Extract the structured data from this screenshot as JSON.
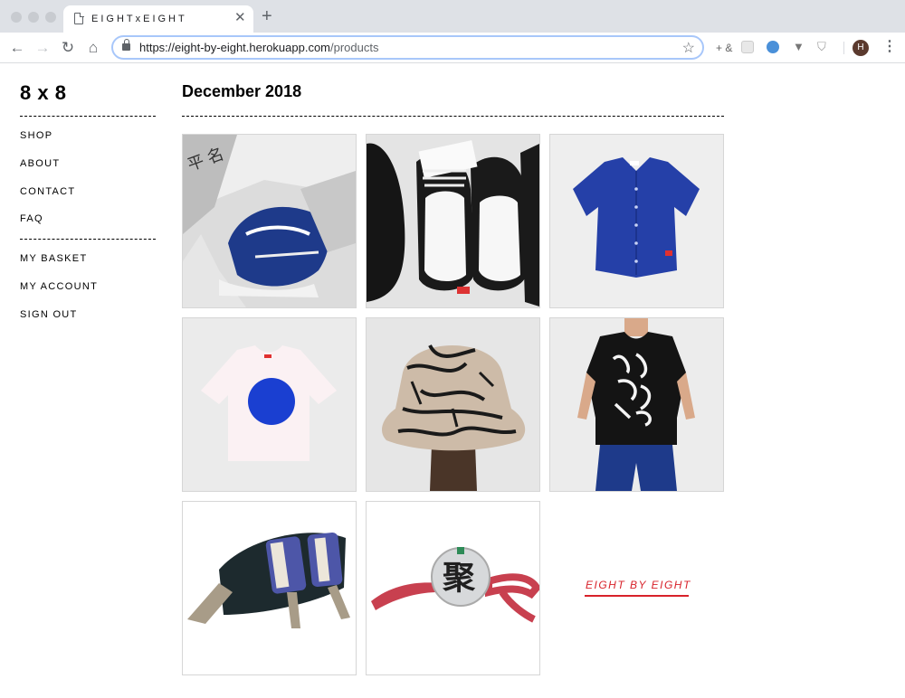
{
  "browser": {
    "tab_title": "EIGHTxEIGHT",
    "url_host": "https://eight-by-eight.herokuapp.com",
    "url_path": "/products",
    "extension_label": "+ &",
    "avatar_initial": "H"
  },
  "site": {
    "logo": "8 x 8",
    "nav_primary": [
      "SHOP",
      "ABOUT",
      "CONTACT",
      "FAQ"
    ],
    "nav_secondary": [
      "MY BASKET",
      "MY ACCOUNT",
      "SIGN OUT"
    ]
  },
  "main": {
    "title": "December 2018",
    "products": [
      {
        "icon": "sneakers-in-bag-image"
      },
      {
        "icon": "sneakers-pair-image"
      },
      {
        "icon": "blue-shirt-image"
      },
      {
        "icon": "white-tee-blue-dot-image"
      },
      {
        "icon": "bucket-hat-image"
      },
      {
        "icon": "black-graphic-tee-image"
      },
      {
        "icon": "hip-bag-image"
      },
      {
        "icon": "round-pouch-image"
      }
    ],
    "brand_card": {
      "text": "EIGHT BY EIGHT",
      "color": "#d8222a"
    }
  }
}
